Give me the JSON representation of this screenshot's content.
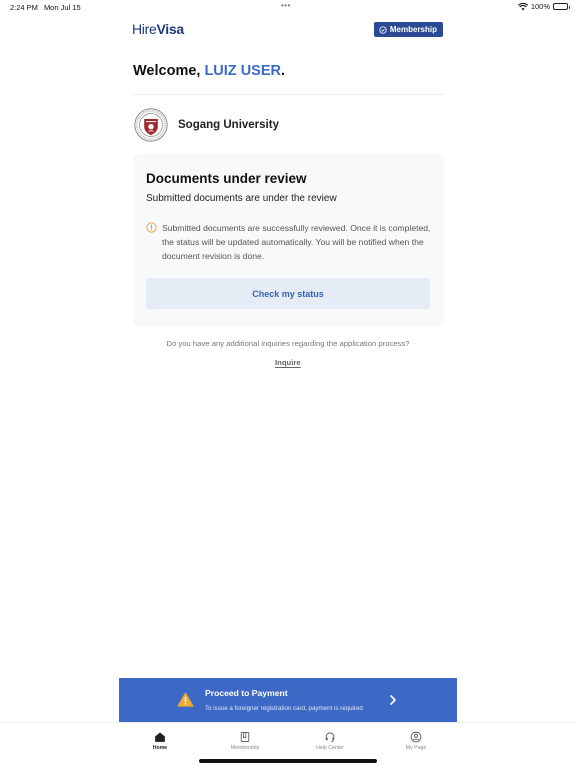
{
  "status_bar": {
    "time": "2:24 PM",
    "date": "Mon Jul 15",
    "battery": "100%"
  },
  "header": {
    "logo_part1": "Hire",
    "logo_part2": "Visa",
    "membership_label": "Membership"
  },
  "welcome": {
    "prefix": "Welcome, ",
    "user": "LUIZ USER",
    "suffix": "."
  },
  "university": {
    "name": "Sogang University"
  },
  "review_card": {
    "title": "Documents under review",
    "subtitle": "Submitted documents are under the review",
    "info": "Submitted documents are successfully reviewed. Once it is completed, the status will be updated automatically. You will be notified when the document revision is done.",
    "button_label": "Check my status"
  },
  "inquiry": {
    "text": "Do you have any additional inquiries regarding the application process?",
    "link_label": "Inquire"
  },
  "payment_banner": {
    "title": "Proceed to Payment",
    "subtitle": "To issue a foreigner registration card, payment is required"
  },
  "tabs": [
    {
      "label": "Home",
      "icon": "home-icon",
      "active": true
    },
    {
      "label": "Membership",
      "icon": "book-icon",
      "active": false
    },
    {
      "label": "Help Center",
      "icon": "headset-icon",
      "active": false
    },
    {
      "label": "My Page",
      "icon": "user-circle-icon",
      "active": false
    }
  ],
  "colors": {
    "brand": "#1e3a7b",
    "accent": "#3d69c6",
    "warning": "#f0a830"
  }
}
